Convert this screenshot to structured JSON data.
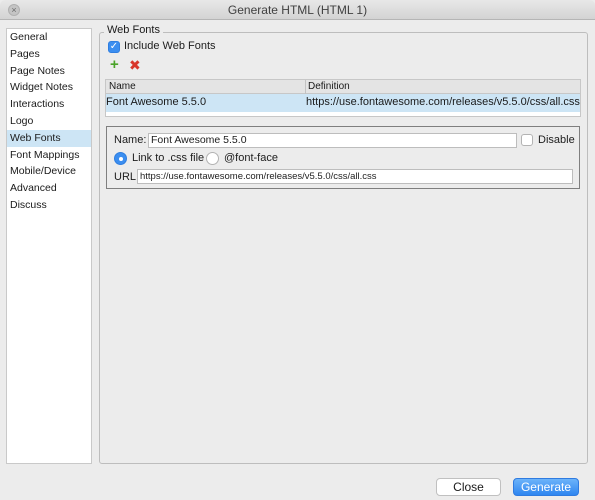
{
  "window": {
    "title": "Generate HTML (HTML 1)"
  },
  "sidebar": {
    "items": [
      {
        "label": "General"
      },
      {
        "label": "Pages"
      },
      {
        "label": "Page Notes"
      },
      {
        "label": "Widget Notes"
      },
      {
        "label": "Interactions"
      },
      {
        "label": "Logo"
      },
      {
        "label": "Web Fonts"
      },
      {
        "label": "Font Mappings"
      },
      {
        "label": "Mobile/Device"
      },
      {
        "label": "Advanced"
      },
      {
        "label": "Discuss"
      }
    ],
    "selected": "Web Fonts"
  },
  "web_fonts": {
    "group_title": "Web Fonts",
    "include_label": "Include Web Fonts",
    "include_checked": true,
    "table": {
      "headers": [
        "Name",
        "Definition"
      ],
      "rows": [
        {
          "name": "Font Awesome 5.5.0",
          "definition": "https://use.fontawesome.com/releases/v5.5.0/css/all.css"
        }
      ]
    },
    "detail": {
      "name_label": "Name:",
      "name_value": "Font Awesome 5.5.0",
      "disable_label": "Disable",
      "disable_checked": false,
      "link_label": "Link to .css file",
      "fontface_label": "@font-face",
      "link_selected": true,
      "url_label": "URL",
      "url_value": "https://use.fontawesome.com/releases/v5.5.0/css/all.css"
    }
  },
  "footer": {
    "close_label": "Close",
    "generate_label": "Generate"
  },
  "icons": {
    "add": "plus-icon",
    "remove": "x-icon",
    "check": "checkmark-icon"
  },
  "colors": {
    "accent": "#3b8ef0",
    "selection": "#cde5f5",
    "add": "#4aa329",
    "remove": "#d8362b"
  }
}
